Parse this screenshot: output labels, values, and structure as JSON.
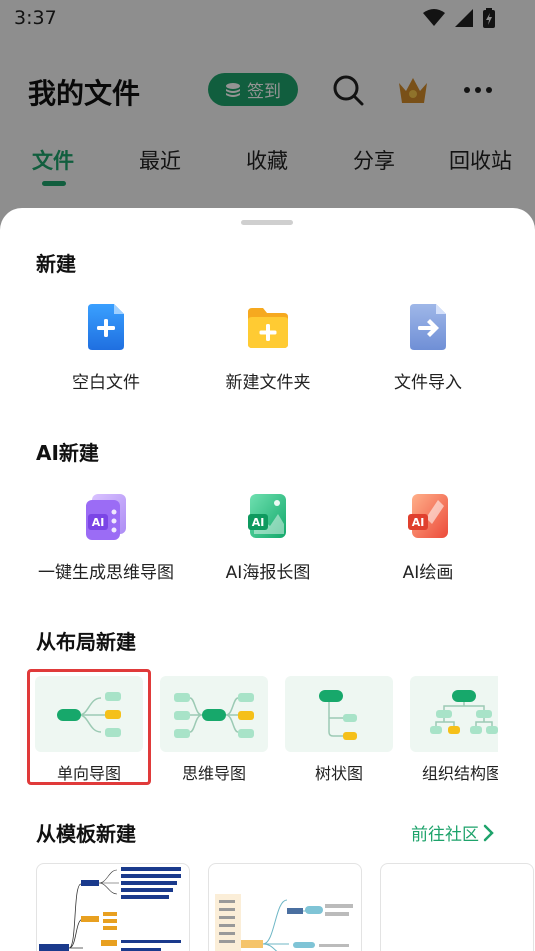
{
  "status_bar": {
    "time": "3:37"
  },
  "header": {
    "title": "我的文件",
    "signin_label": "签到"
  },
  "tabs": [
    {
      "label": "文件",
      "active": true
    },
    {
      "label": "最近"
    },
    {
      "label": "收藏"
    },
    {
      "label": "分享"
    },
    {
      "label": "回收站"
    }
  ],
  "sheet": {
    "new_section": {
      "title": "新建",
      "items": [
        {
          "label": "空白文件",
          "icon": "blank-file-icon"
        },
        {
          "label": "新建文件夹",
          "icon": "new-folder-icon"
        },
        {
          "label": "文件导入",
          "icon": "file-import-icon"
        }
      ]
    },
    "ai_section": {
      "title": "AI新建",
      "items": [
        {
          "label": "一键生成思维导图",
          "icon": "ai-mindmap-icon"
        },
        {
          "label": "AI海报长图",
          "icon": "ai-poster-icon"
        },
        {
          "label": "AI绘画",
          "icon": "ai-painting-icon"
        }
      ],
      "icon_text": "AI"
    },
    "layout_section": {
      "title": "从布局新建",
      "items": [
        {
          "label": "单向导图"
        },
        {
          "label": "思维导图"
        },
        {
          "label": "树状图"
        },
        {
          "label": "组织结构图"
        }
      ]
    },
    "template_section": {
      "title": "从模板新建",
      "community_link": "前往社区"
    }
  },
  "colors": {
    "brand_green": "#1ea36b",
    "highlight_red": "#e03a3a",
    "node_green": "#17a86b",
    "node_light_green": "#a8e3c8",
    "node_yellow": "#f5c01a"
  }
}
